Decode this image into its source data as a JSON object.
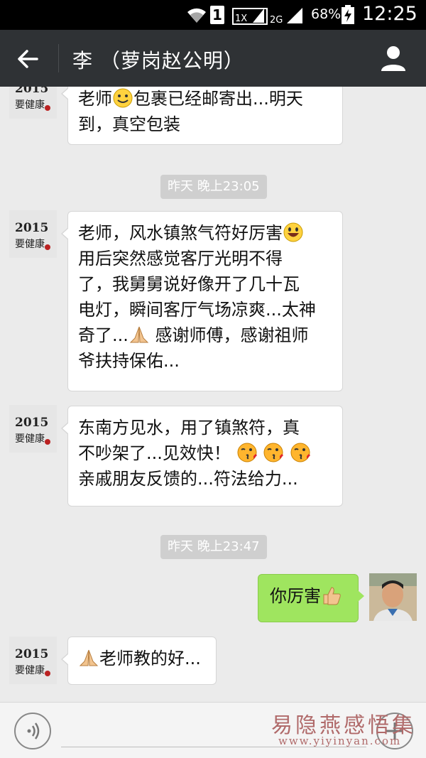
{
  "status_bar": {
    "sim_slot": "1",
    "network1": "1X",
    "network2": "2G",
    "battery": "68%",
    "time": "12:25"
  },
  "header": {
    "title": "李   （萝岗赵公明）"
  },
  "messages": [
    {
      "text_a": "老师",
      "text_b": "包裹已经邮寄出...明天",
      "line2": "到，真空包装"
    },
    {
      "time": "昨天 晚上23:05"
    },
    {
      "line1": "老师，风水镇煞气符好厉害",
      "line2": "用后突然感觉客厅光明不得",
      "line3": "了，我舅舅说好像开了几十瓦",
      "line4": "电灯，瞬间客厅气场凉爽...太神",
      "line5a": "奇了...",
      "line5b": " 感谢师傅，感谢祖师",
      "line6": "爷扶持保佑..."
    },
    {
      "line1": "东南方见水，用了镇煞符，真",
      "line2": "不吵架了...见效快！",
      "line3": "亲戚朋友反馈的...符法给力..."
    },
    {
      "time": "昨天 晚上23:47"
    },
    {
      "text": "你厉害"
    },
    {
      "text": "老师教的好..."
    }
  ],
  "avatar_logo_text": "2015 要健康",
  "watermark": {
    "main": "易隐燕感悟集",
    "url": "www.yiyinyan.com"
  },
  "icons": [
    "wifi-icon",
    "signal-icon",
    "battery-icon",
    "back-arrow-icon",
    "contact-icon",
    "voice-icon",
    "plus-icon",
    "smile-emoji",
    "grin-emoji",
    "pray-emoji",
    "kiss-emoji",
    "thumbs-up-emoji"
  ]
}
